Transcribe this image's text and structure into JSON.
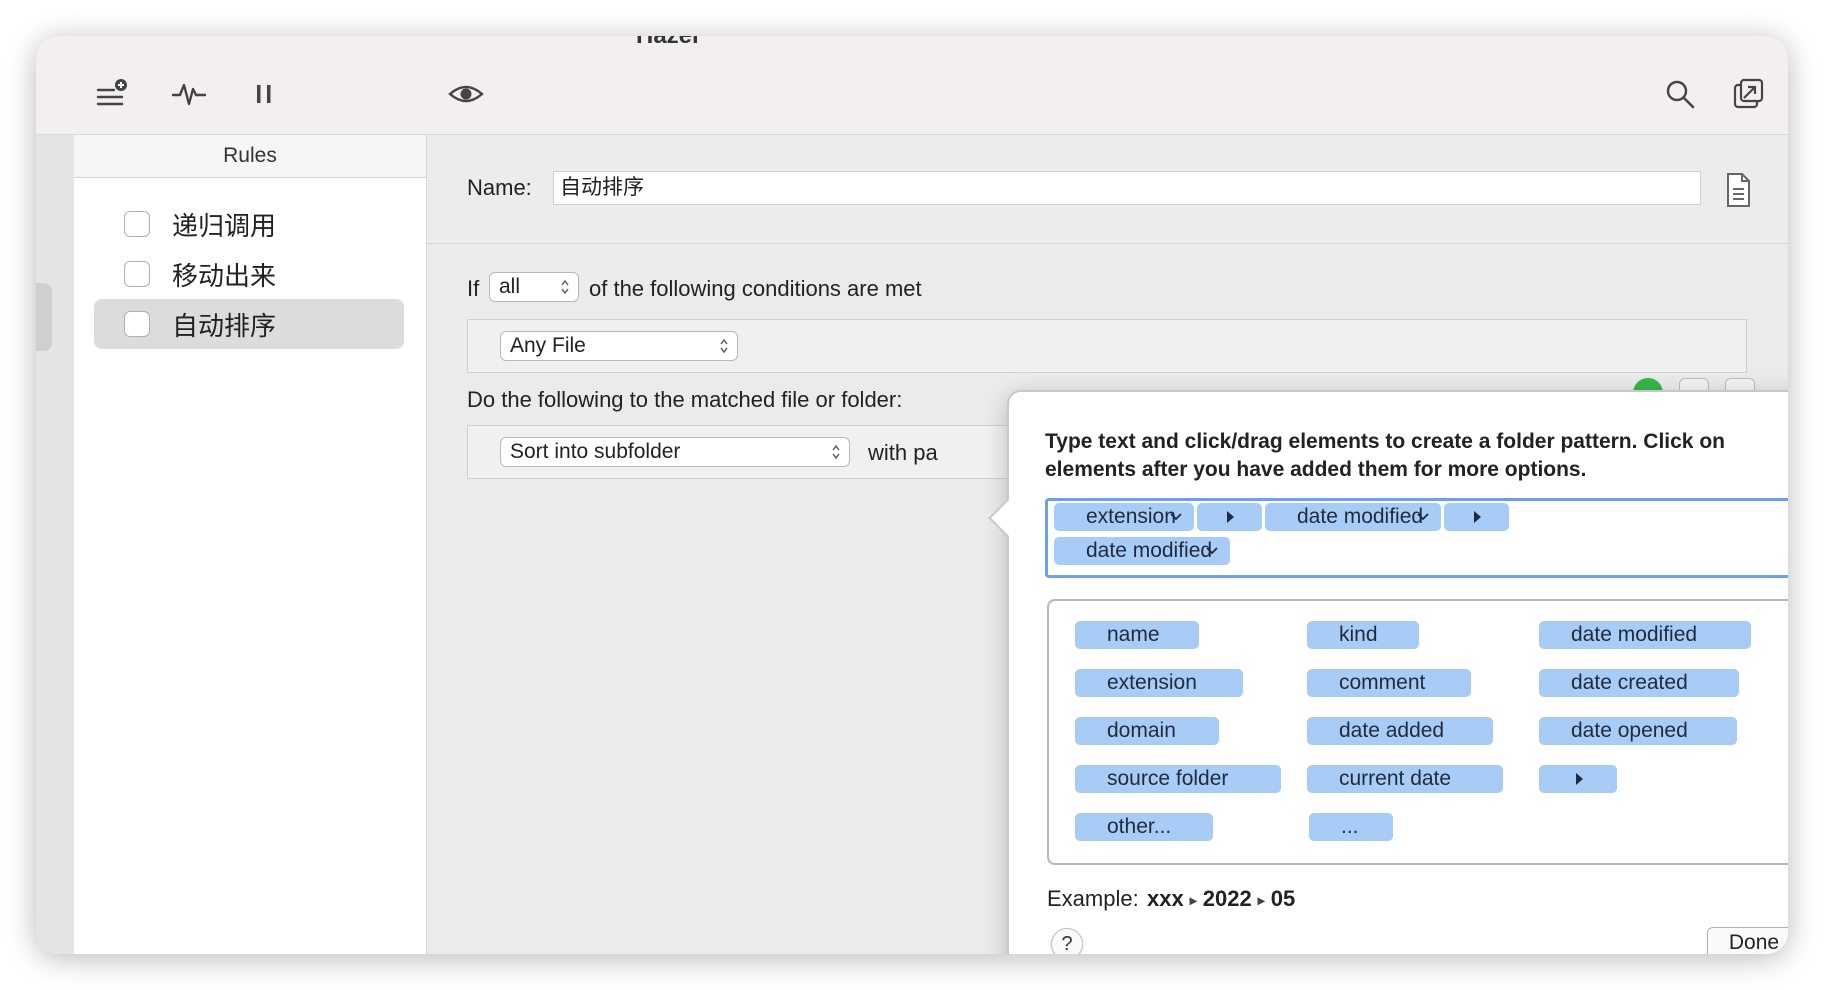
{
  "app": {
    "title": "Hazel"
  },
  "sidebar": {
    "header": "Rules",
    "rules": [
      {
        "label": "递归调用",
        "checked": false,
        "selected": false
      },
      {
        "label": "移动出来",
        "checked": false,
        "selected": false
      },
      {
        "label": "自动排序",
        "checked": false,
        "selected": true
      }
    ]
  },
  "rule_editor": {
    "name_label": "Name:",
    "name_value": "自动排序",
    "conditions": {
      "if_label": "If",
      "match_select": "all",
      "suffix": "of the following conditions are met",
      "condition_select": "Any File"
    },
    "actions": {
      "label": "Do the following to the matched file or folder:",
      "action_select": "Sort into subfolder",
      "with_text": "with pa"
    }
  },
  "pattern_popover": {
    "instructions": "Type text and click/drag elements to create a folder pattern. Click on elements after you have added them for more options.",
    "pattern_tokens": [
      "extension",
      "date modified",
      "date modified"
    ],
    "palette": {
      "col1": [
        "name",
        "extension",
        "domain",
        "source folder",
        "other..."
      ],
      "col2": [
        "kind",
        "comment",
        "date added",
        "current date",
        "..."
      ],
      "col3": [
        "date modified",
        "date created",
        "date opened"
      ]
    },
    "example_label": "Example:",
    "example_parts": [
      "xxx",
      "2022",
      "05"
    ],
    "help_label": "?",
    "done_label": "Done"
  },
  "colors": {
    "token_bg": "#a9ccf7",
    "focus_ring": "#6c9ff1",
    "toolbar_bg": "#f3eef2",
    "green_status": "#35b84a"
  },
  "icons": [
    "add-rule-icon",
    "activity-icon",
    "pause-icon",
    "eye-icon",
    "search-icon",
    "detach-window-icon",
    "document-icon"
  ]
}
